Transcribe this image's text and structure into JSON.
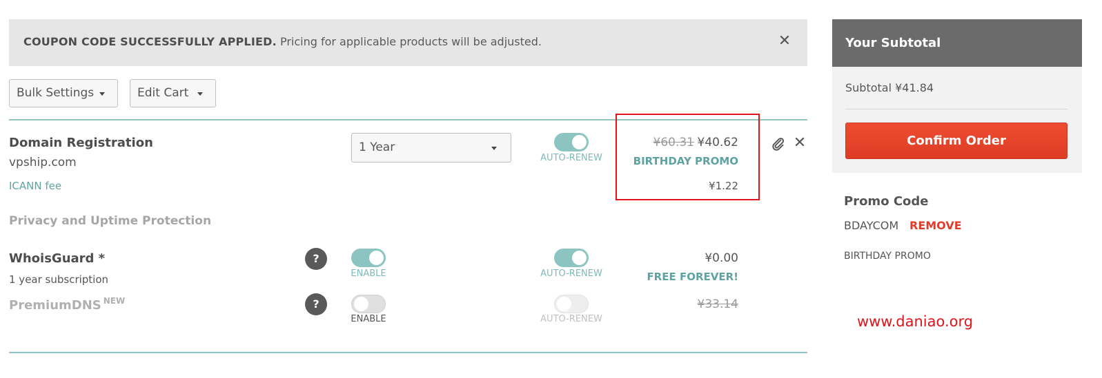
{
  "alert": {
    "title": "COUPON CODE SUCCESSFULLY APPLIED.",
    "message": "Pricing for applicable products will be adjusted.",
    "close_icon": "close-icon"
  },
  "toolbar": {
    "bulk_label": "Bulk Settings",
    "edit_label": "Edit Cart"
  },
  "domain": {
    "title": "Domain Registration",
    "name": "vpship.com",
    "icann_label": "ICANN fee",
    "period": "1 Year",
    "auto_renew_label": "AUTO-RENEW",
    "old_price": "¥60.31",
    "price": "¥40.62",
    "promo": "BIRTHDAY PROMO",
    "icann_price": "¥1.22"
  },
  "protection": {
    "section_title": "Privacy and Uptime Protection",
    "whoisguard": {
      "title": "WhoisGuard *",
      "subtitle": "1 year subscription",
      "help": "?",
      "enable_label": "ENABLE",
      "auto_renew_label": "AUTO-RENEW",
      "price": "¥0.00",
      "note": "FREE FOREVER!"
    },
    "premiumdns": {
      "title": "PremiumDNS",
      "badge": "NEW",
      "help": "?",
      "enable_label": "ENABLE",
      "auto_renew_label": "AUTO-RENEW",
      "price": "¥33.14"
    }
  },
  "summary": {
    "header": "Your Subtotal",
    "subtotal": "Subtotal ¥41.84",
    "confirm_label": "Confirm Order"
  },
  "promo": {
    "header": "Promo Code",
    "code": "BDAYCOM",
    "remove_label": "REMOVE",
    "description": "BIRTHDAY PROMO"
  },
  "watermark": "www.daniao.org",
  "colors": {
    "accent": "#8cc4c2",
    "confirm": "#e8452c",
    "highlight": "#e0141a"
  }
}
